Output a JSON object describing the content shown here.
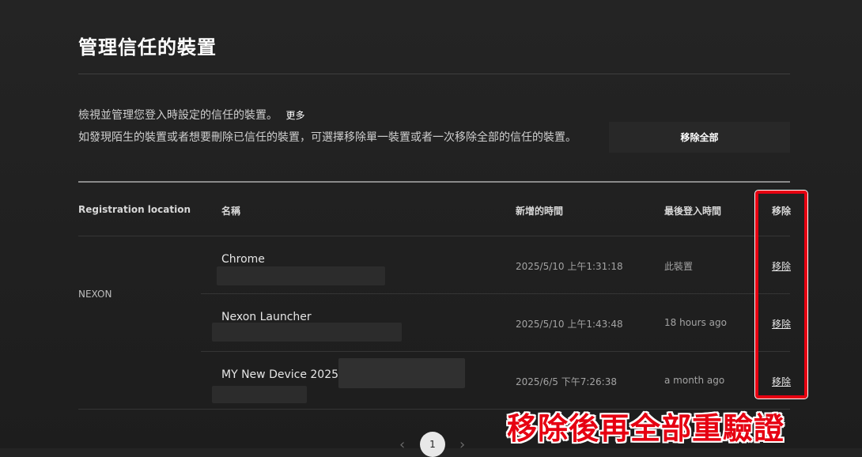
{
  "header": {
    "title": "管理信任的裝置"
  },
  "intro": {
    "line1": "檢視並管理您登入時設定的信任的裝置。",
    "more_label": "更多",
    "line2": "如發現陌生的裝置或者想要刪除已信任的裝置，可選擇移除單一裝置或者一次移除全部的信任的裝置。",
    "remove_all_label": "移除全部"
  },
  "table": {
    "columns": {
      "location": "Registration location",
      "name": "名稱",
      "added": "新增的時間",
      "last_login": "最後登入時間",
      "remove": "移除"
    },
    "provider": "NEXON",
    "rows": [
      {
        "name": "Chrome",
        "added": "2025/5/10 上午1:31:18",
        "last_login": "此裝置",
        "remove_label": "移除"
      },
      {
        "name": "Nexon Launcher",
        "added": "2025/5/10 上午1:43:48",
        "last_login": "18 hours ago",
        "remove_label": "移除"
      },
      {
        "name": "MY New Device 2025",
        "added": "2025/6/5 下午7:26:38",
        "last_login": "a month ago",
        "remove_label": "移除"
      }
    ]
  },
  "pagination": {
    "prev": "‹",
    "current": "1",
    "next": "›"
  },
  "annotation": {
    "text": "移除後再全部重驗證",
    "color": "#e60012"
  }
}
